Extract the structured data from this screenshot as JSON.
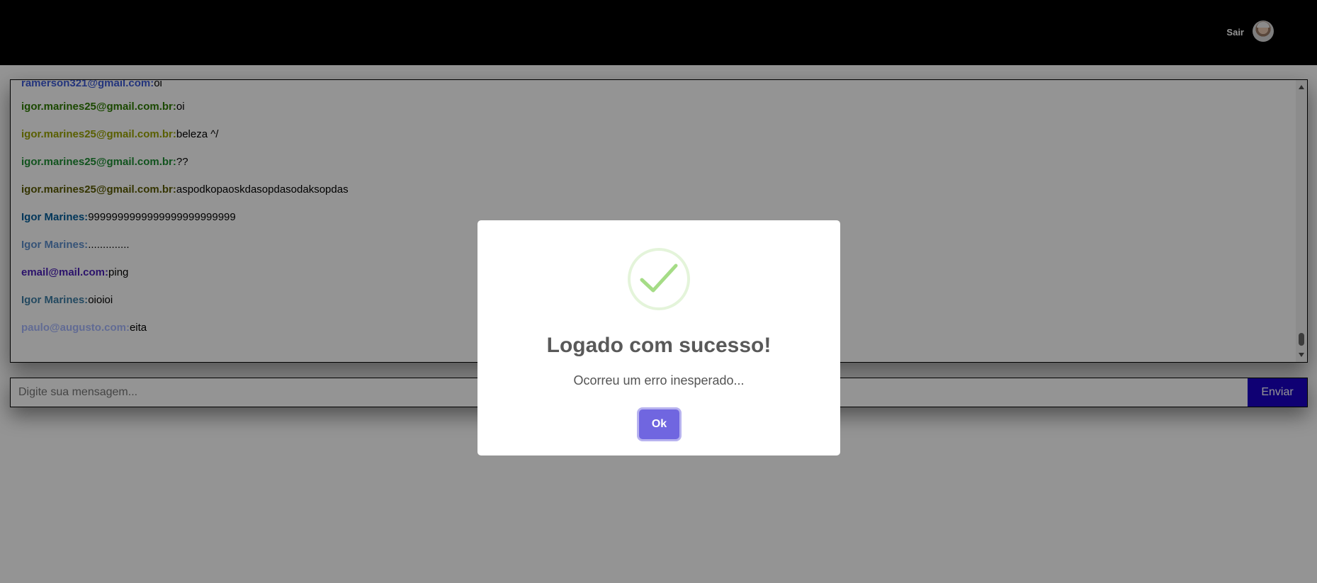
{
  "header": {
    "logout_label": "Sair",
    "avatar_icon": "user-avatar"
  },
  "chat": {
    "messages": [
      {
        "author": "ramerson321@gmail.com:",
        "text": "oi",
        "color": "#3d5bd6"
      },
      {
        "author": "igor.marines25@gmail.com.br:",
        "text": "oi",
        "color": "#2e7d00"
      },
      {
        "author": "igor.marines25@gmail.com.br:",
        "text": "beleza ^/",
        "color": "#9aa400"
      },
      {
        "author": "igor.marines25@gmail.com.br:",
        "text": "??",
        "color": "#1e8f34"
      },
      {
        "author": "igor.marines25@gmail.com.br:",
        "text": "aspodkopaoskdasopdasodaksopdas",
        "color": "#5a5a00"
      },
      {
        "author": "Igor Marines:",
        "text": "9999999999999999999999999",
        "color": "#005e9c"
      },
      {
        "author": "Igor Marines:",
        "text": "..............",
        "color": "#5d8fce"
      },
      {
        "author": "email@mail.com:",
        "text": "ping",
        "color": "#4b1fb8"
      },
      {
        "author": "Igor Marines:",
        "text": "oioioi",
        "color": "#3e7fa6"
      },
      {
        "author": "paulo@augusto.com:",
        "text": "eita",
        "color": "#a8b9ff"
      }
    ]
  },
  "composer": {
    "placeholder": "Digite sua mensagem...",
    "send_label": "Enviar"
  },
  "modal": {
    "icon": "success-check-icon",
    "title": "Logado com sucesso!",
    "text": "Ocorreu um erro inesperado...",
    "ok_label": "Ok"
  },
  "colors": {
    "header_bg": "#000000",
    "send_button": "#1a00c7",
    "modal_ok_button": "#7066e0",
    "success_check": "#a5dc86"
  }
}
